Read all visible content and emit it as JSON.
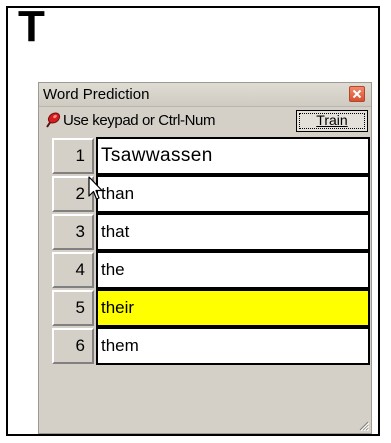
{
  "document": {
    "letter": "T"
  },
  "window": {
    "title": "Word Prediction",
    "close_icon": "close-icon",
    "hint_icon": "red-pushpin-icon",
    "hint_text": "Use keypad or Ctrl-Num",
    "train_label": "Train",
    "accent_colors": {
      "highlight": "#ffff00",
      "title_bar": "#d4d0c8",
      "close_button": "#e0603f"
    }
  },
  "predictions": [
    {
      "number": "1",
      "word": "Tsawwassen",
      "highlighted": false
    },
    {
      "number": "2",
      "word": "than",
      "highlighted": false
    },
    {
      "number": "3",
      "word": "that",
      "highlighted": false
    },
    {
      "number": "4",
      "word": "the",
      "highlighted": false
    },
    {
      "number": "5",
      "word": "their",
      "highlighted": true
    },
    {
      "number": "6",
      "word": "them",
      "highlighted": false
    }
  ]
}
